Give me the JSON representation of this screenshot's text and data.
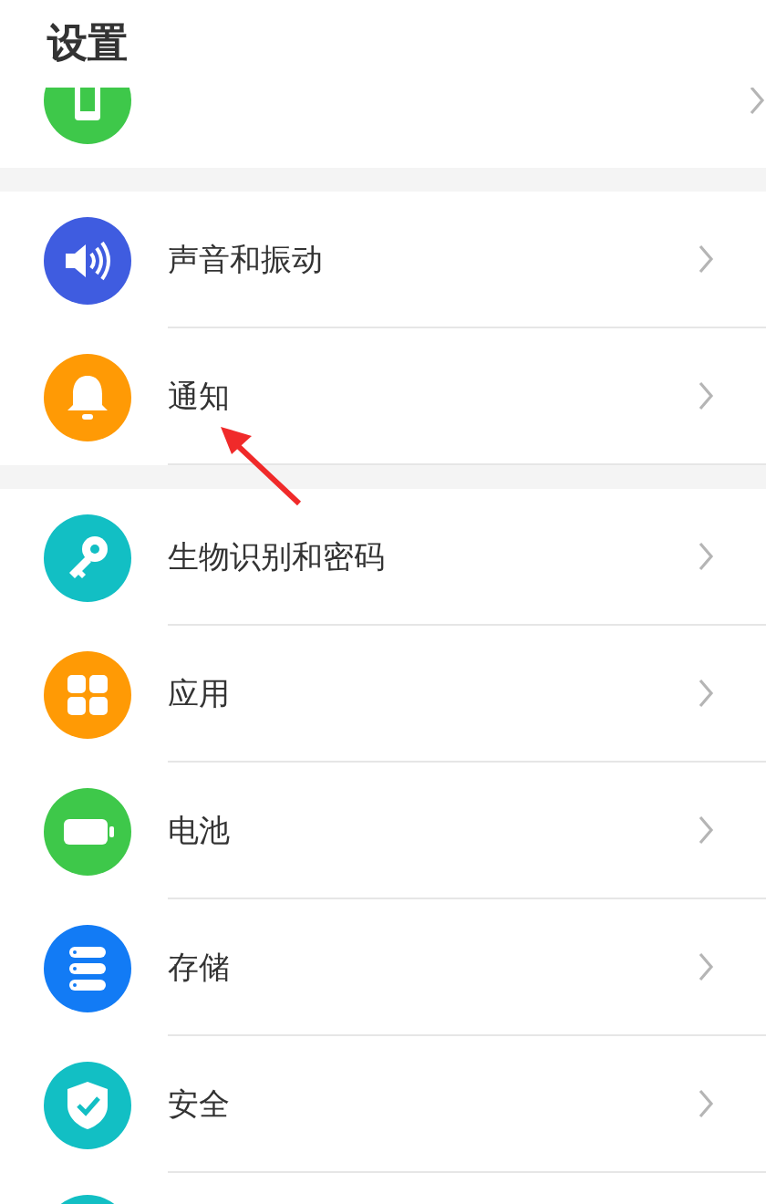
{
  "header": {
    "title": "设置"
  },
  "top_partial_row": {
    "color": "#3ec84a"
  },
  "groups": [
    {
      "items": [
        {
          "label": "声音和振动",
          "kind": "sound",
          "color": "#3f5ce0"
        },
        {
          "label": "通知",
          "kind": "bell",
          "color": "#ff9a05"
        }
      ]
    },
    {
      "items": [
        {
          "label": "生物识别和密码",
          "kind": "key",
          "color": "#12bfc4"
        },
        {
          "label": "应用",
          "kind": "apps",
          "color": "#ff9a05"
        },
        {
          "label": "电池",
          "kind": "battery",
          "color": "#3ec84a"
        },
        {
          "label": "存储",
          "kind": "storage",
          "color": "#127bf5"
        },
        {
          "label": "安全",
          "kind": "shield",
          "color": "#12bfc4"
        }
      ]
    }
  ],
  "bottom_partial_row": {
    "color": "#12bfc4"
  },
  "annotation": {
    "kind": "arrow",
    "color": "#f02a2a"
  }
}
